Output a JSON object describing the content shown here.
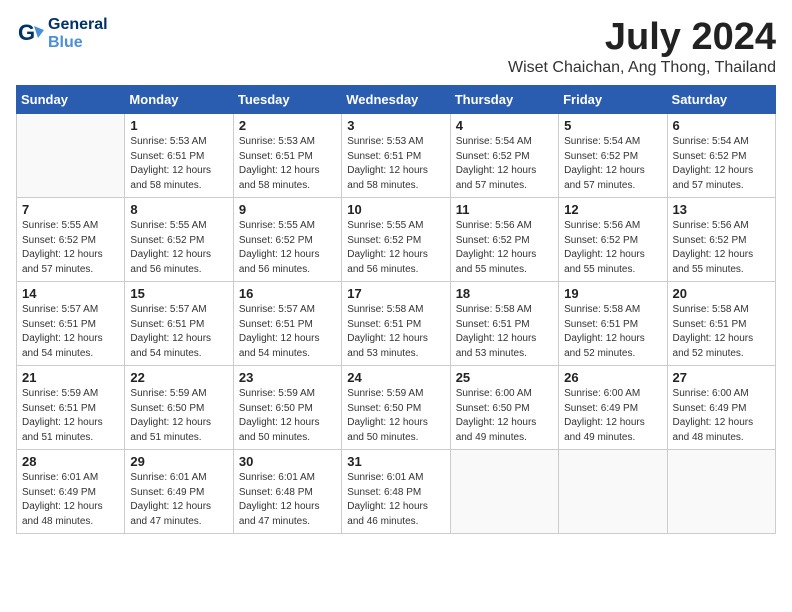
{
  "header": {
    "logo_line1": "General",
    "logo_line2": "Blue",
    "month_title": "July 2024",
    "location": "Wiset Chaichan, Ang Thong, Thailand"
  },
  "weekdays": [
    "Sunday",
    "Monday",
    "Tuesday",
    "Wednesday",
    "Thursday",
    "Friday",
    "Saturday"
  ],
  "weeks": [
    [
      {
        "day": "",
        "info": ""
      },
      {
        "day": "1",
        "info": "Sunrise: 5:53 AM\nSunset: 6:51 PM\nDaylight: 12 hours\nand 58 minutes."
      },
      {
        "day": "2",
        "info": "Sunrise: 5:53 AM\nSunset: 6:51 PM\nDaylight: 12 hours\nand 58 minutes."
      },
      {
        "day": "3",
        "info": "Sunrise: 5:53 AM\nSunset: 6:51 PM\nDaylight: 12 hours\nand 58 minutes."
      },
      {
        "day": "4",
        "info": "Sunrise: 5:54 AM\nSunset: 6:52 PM\nDaylight: 12 hours\nand 57 minutes."
      },
      {
        "day": "5",
        "info": "Sunrise: 5:54 AM\nSunset: 6:52 PM\nDaylight: 12 hours\nand 57 minutes."
      },
      {
        "day": "6",
        "info": "Sunrise: 5:54 AM\nSunset: 6:52 PM\nDaylight: 12 hours\nand 57 minutes."
      }
    ],
    [
      {
        "day": "7",
        "info": "Sunrise: 5:55 AM\nSunset: 6:52 PM\nDaylight: 12 hours\nand 57 minutes."
      },
      {
        "day": "8",
        "info": "Sunrise: 5:55 AM\nSunset: 6:52 PM\nDaylight: 12 hours\nand 56 minutes."
      },
      {
        "day": "9",
        "info": "Sunrise: 5:55 AM\nSunset: 6:52 PM\nDaylight: 12 hours\nand 56 minutes."
      },
      {
        "day": "10",
        "info": "Sunrise: 5:55 AM\nSunset: 6:52 PM\nDaylight: 12 hours\nand 56 minutes."
      },
      {
        "day": "11",
        "info": "Sunrise: 5:56 AM\nSunset: 6:52 PM\nDaylight: 12 hours\nand 55 minutes."
      },
      {
        "day": "12",
        "info": "Sunrise: 5:56 AM\nSunset: 6:52 PM\nDaylight: 12 hours\nand 55 minutes."
      },
      {
        "day": "13",
        "info": "Sunrise: 5:56 AM\nSunset: 6:52 PM\nDaylight: 12 hours\nand 55 minutes."
      }
    ],
    [
      {
        "day": "14",
        "info": "Sunrise: 5:57 AM\nSunset: 6:51 PM\nDaylight: 12 hours\nand 54 minutes."
      },
      {
        "day": "15",
        "info": "Sunrise: 5:57 AM\nSunset: 6:51 PM\nDaylight: 12 hours\nand 54 minutes."
      },
      {
        "day": "16",
        "info": "Sunrise: 5:57 AM\nSunset: 6:51 PM\nDaylight: 12 hours\nand 54 minutes."
      },
      {
        "day": "17",
        "info": "Sunrise: 5:58 AM\nSunset: 6:51 PM\nDaylight: 12 hours\nand 53 minutes."
      },
      {
        "day": "18",
        "info": "Sunrise: 5:58 AM\nSunset: 6:51 PM\nDaylight: 12 hours\nand 53 minutes."
      },
      {
        "day": "19",
        "info": "Sunrise: 5:58 AM\nSunset: 6:51 PM\nDaylight: 12 hours\nand 52 minutes."
      },
      {
        "day": "20",
        "info": "Sunrise: 5:58 AM\nSunset: 6:51 PM\nDaylight: 12 hours\nand 52 minutes."
      }
    ],
    [
      {
        "day": "21",
        "info": "Sunrise: 5:59 AM\nSunset: 6:51 PM\nDaylight: 12 hours\nand 51 minutes."
      },
      {
        "day": "22",
        "info": "Sunrise: 5:59 AM\nSunset: 6:50 PM\nDaylight: 12 hours\nand 51 minutes."
      },
      {
        "day": "23",
        "info": "Sunrise: 5:59 AM\nSunset: 6:50 PM\nDaylight: 12 hours\nand 50 minutes."
      },
      {
        "day": "24",
        "info": "Sunrise: 5:59 AM\nSunset: 6:50 PM\nDaylight: 12 hours\nand 50 minutes."
      },
      {
        "day": "25",
        "info": "Sunrise: 6:00 AM\nSunset: 6:50 PM\nDaylight: 12 hours\nand 49 minutes."
      },
      {
        "day": "26",
        "info": "Sunrise: 6:00 AM\nSunset: 6:49 PM\nDaylight: 12 hours\nand 49 minutes."
      },
      {
        "day": "27",
        "info": "Sunrise: 6:00 AM\nSunset: 6:49 PM\nDaylight: 12 hours\nand 48 minutes."
      }
    ],
    [
      {
        "day": "28",
        "info": "Sunrise: 6:01 AM\nSunset: 6:49 PM\nDaylight: 12 hours\nand 48 minutes."
      },
      {
        "day": "29",
        "info": "Sunrise: 6:01 AM\nSunset: 6:49 PM\nDaylight: 12 hours\nand 47 minutes."
      },
      {
        "day": "30",
        "info": "Sunrise: 6:01 AM\nSunset: 6:48 PM\nDaylight: 12 hours\nand 47 minutes."
      },
      {
        "day": "31",
        "info": "Sunrise: 6:01 AM\nSunset: 6:48 PM\nDaylight: 12 hours\nand 46 minutes."
      },
      {
        "day": "",
        "info": ""
      },
      {
        "day": "",
        "info": ""
      },
      {
        "day": "",
        "info": ""
      }
    ]
  ]
}
